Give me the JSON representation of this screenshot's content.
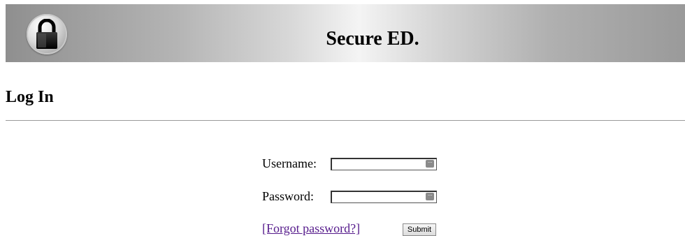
{
  "header": {
    "title": "Secure ED.",
    "logo_icon": "lock-icon"
  },
  "main": {
    "page_title": "Log In"
  },
  "form": {
    "username_label": "Username:",
    "username_value": "",
    "password_label": "Password:",
    "password_value": "",
    "forgot_link_label": "[Forgot password?]",
    "submit_label": "Submit",
    "autofill_icon": "password-manager-icon",
    "autofill_glyph": "···"
  },
  "colors": {
    "link_visited": "#551a8b",
    "divider": "#9a9a9a"
  }
}
